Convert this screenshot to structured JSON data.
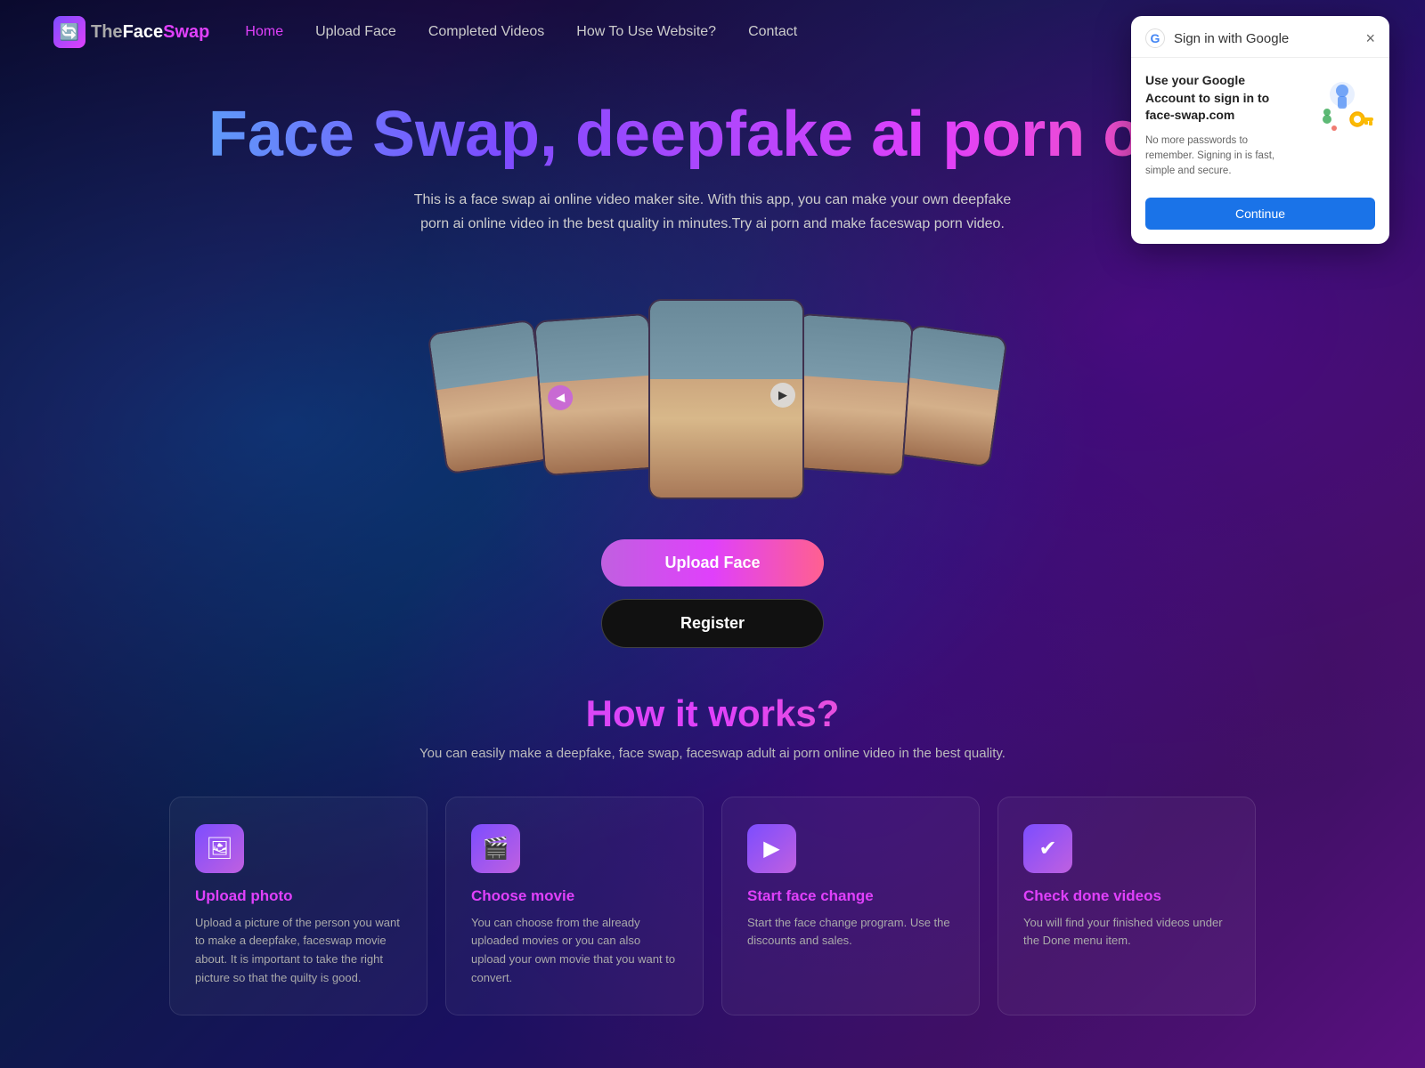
{
  "site": {
    "logo_the": "The",
    "logo_face": "Face",
    "logo_swap": "Swap"
  },
  "nav": {
    "links": [
      {
        "label": "Home",
        "active": true
      },
      {
        "label": "Upload Face",
        "active": false
      },
      {
        "label": "Completed Videos",
        "active": false
      },
      {
        "label": "How To Use Website?",
        "active": false
      },
      {
        "label": "Contact",
        "active": false
      }
    ]
  },
  "hero": {
    "title": "Face Swap, deepfake ai porn onli",
    "subtitle": "This is a face swap ai online video maker site. With this app, you can make your own deepfake porn ai online video in the best quality in minutes.Try ai porn and make faceswap porn video.",
    "btn_upload": "Upload Face",
    "btn_register": "Register"
  },
  "how": {
    "title": "How it works?",
    "subtitle": "You can easily make a deepfake, face swap, faceswap adult ai porn online video in the best quality.",
    "cards": [
      {
        "id": "upload-photo",
        "icon": "🖼",
        "title": "Upload photo",
        "desc": "Upload a picture of the person you want to make a deepfake, faceswap movie about. It is important to take the right picture so that the quilty is good."
      },
      {
        "id": "choose-movie",
        "icon": "🎬",
        "title": "Choose movie",
        "desc": "You can choose from the already uploaded movies or you can also upload your own movie that you want to convert."
      },
      {
        "id": "start-face-change",
        "icon": "▶",
        "title": "Start face change",
        "desc": "Start the face change program. Use the discounts and sales."
      },
      {
        "id": "check-done-videos",
        "icon": "✓",
        "title": "Check done videos",
        "desc": "You will find your finished videos under the Done menu item."
      }
    ]
  },
  "google_popup": {
    "header_title": "Sign in with Google",
    "close_label": "×",
    "main_text": "Use your Google Account to sign in to face-swap.com",
    "sub_text": "No more passwords to remember. Signing in is fast, simple and secure.",
    "btn_continue": "Continue"
  }
}
